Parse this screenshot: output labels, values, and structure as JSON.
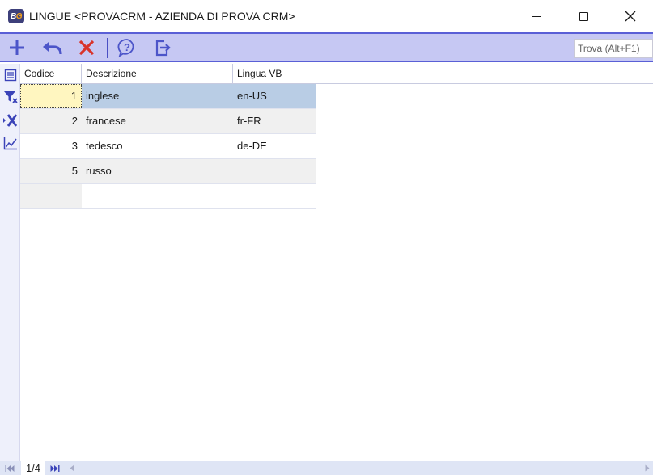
{
  "window": {
    "logo_text_a": "B",
    "logo_text_b": "G",
    "title": "LINGUE <PROVACRM - AZIENDA DI PROVA CRM>"
  },
  "toolbar": {
    "buttons": [
      {
        "name": "add-button",
        "icon": "plus-icon"
      },
      {
        "name": "undo-button",
        "icon": "undo-arrow-icon"
      },
      {
        "name": "delete-button",
        "icon": "red-x-icon"
      },
      {
        "name": "help-button",
        "icon": "help-icon"
      },
      {
        "name": "exit-button",
        "icon": "exit-icon"
      }
    ],
    "search_placeholder": "Trova (Alt+F1)"
  },
  "sidebar": [
    "list-view-icon",
    "filter-icon",
    "clear-filter-icon",
    "chart-icon"
  ],
  "table": {
    "columns": [
      "Codice",
      "Descrizione",
      "Lingua VB"
    ],
    "rows": [
      {
        "codice": "1",
        "descrizione": "inglese",
        "lingua_vb": "en-US"
      },
      {
        "codice": "2",
        "descrizione": "francese",
        "lingua_vb": "fr-FR"
      },
      {
        "codice": "3",
        "descrizione": "tedesco",
        "lingua_vb": "de-DE"
      },
      {
        "codice": "5",
        "descrizione": "russo",
        "lingua_vb": ""
      }
    ]
  },
  "status": {
    "page": "1/4"
  },
  "colors": {
    "toolbar_bg": "#c6c8f3",
    "toolbar_border": "#5a5fd6",
    "selected_row": "#b9cde5",
    "icon_blue": "#4c55c9",
    "delete_red": "#d9342b"
  }
}
